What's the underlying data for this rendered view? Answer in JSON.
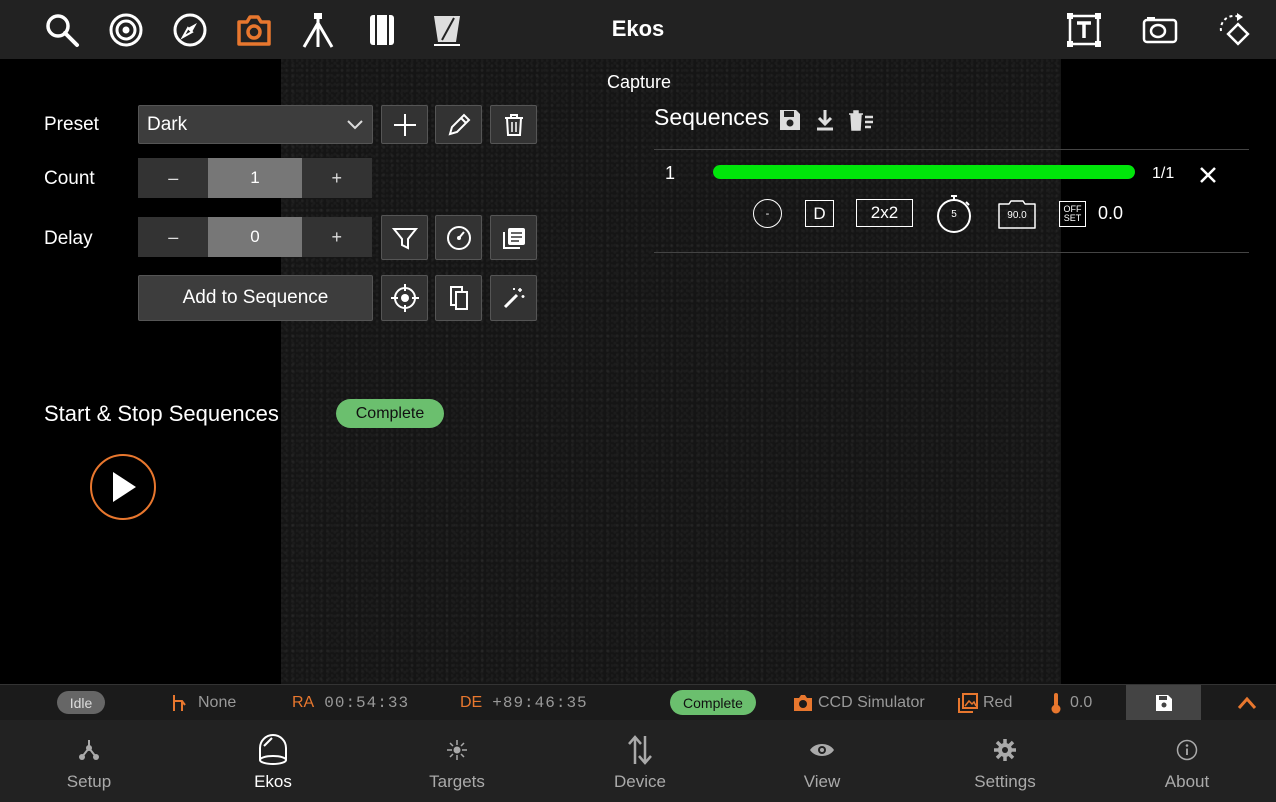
{
  "app": {
    "title": "Ekos",
    "module_title": "Capture"
  },
  "toolbar": {
    "left_icons": [
      "search-icon",
      "target-icon",
      "compass-icon",
      "camera-icon",
      "tripod-icon",
      "notebook-icon",
      "telescope-icon"
    ],
    "right_icons": [
      "text-overlay-icon",
      "frame-icon",
      "rotate-icon"
    ],
    "active_icon": "camera-icon"
  },
  "form": {
    "preset_label": "Preset",
    "preset_value": "Dark",
    "count_label": "Count",
    "count_value": "1",
    "delay_label": "Delay",
    "delay_value": "0",
    "minus": "–",
    "plus": "+",
    "add_to_sequence": "Add to Sequence"
  },
  "control": {
    "title": "Start & Stop Sequences",
    "status": "Complete"
  },
  "sequences": {
    "title": "Sequences",
    "items": [
      {
        "index": "1",
        "progress": 1.0,
        "count": "1/1",
        "filter": "-",
        "frame_type": "D",
        "binning": "2x2",
        "exposure": "5",
        "gain": "90.0",
        "offset_label_top": "OFF",
        "offset_label_bottom": "SET",
        "offset": "0.0"
      }
    ]
  },
  "statusbar": {
    "mount_status": "Idle",
    "park_value": "None",
    "ra_label": "RA",
    "ra_value": "00:54:33",
    "de_label": "DE",
    "de_value": "+89:46:35",
    "capture_status": "Complete",
    "camera": "CCD Simulator",
    "filter": "Red",
    "temperature": "0.0"
  },
  "nav": {
    "items": [
      {
        "label": "Setup",
        "icon": "setup-icon"
      },
      {
        "label": "Ekos",
        "icon": "ekos-icon"
      },
      {
        "label": "Targets",
        "icon": "targets-icon"
      },
      {
        "label": "Device",
        "icon": "device-icon"
      },
      {
        "label": "View",
        "icon": "eye-icon"
      },
      {
        "label": "Settings",
        "icon": "gear-icon"
      },
      {
        "label": "About",
        "icon": "info-icon"
      }
    ],
    "active": "Ekos"
  },
  "colors": {
    "accent": "#e8772e",
    "progress": "#00e60a",
    "badge": "#6bbf6e",
    "topbar": "#222222"
  }
}
